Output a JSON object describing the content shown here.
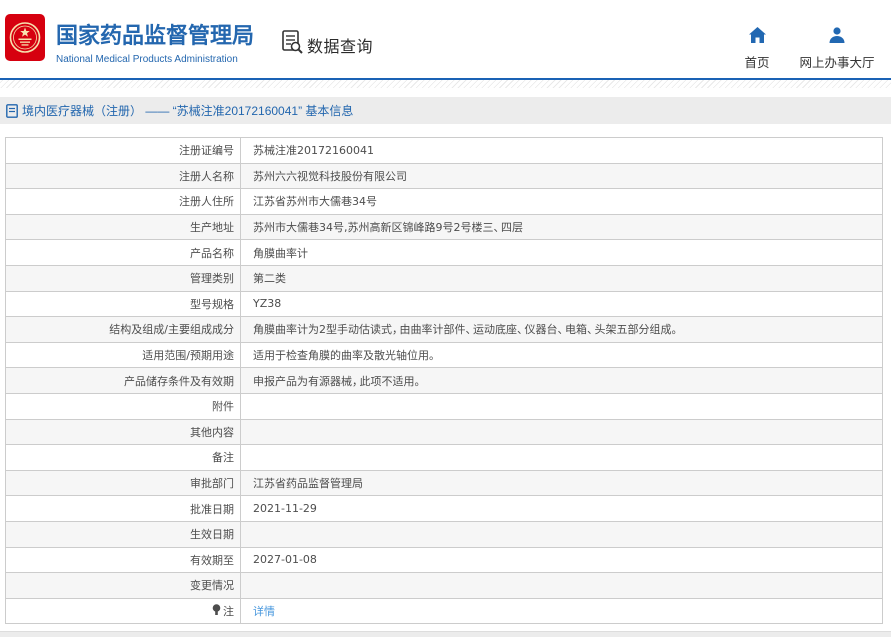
{
  "header": {
    "title_cn": "国家药品监督管理局",
    "title_en": "National Medical Products Administration",
    "section_label": "数据查询",
    "nav_home": "首页",
    "nav_hall": "网上办事大厅"
  },
  "breadcrumb": {
    "text": "境内医疗器械（注册） —— “苏械注准20172160041” 基本信息"
  },
  "table": {
    "rows": [
      {
        "label": "注册证编号",
        "value": "苏械注准20172160041"
      },
      {
        "label": "注册人名称",
        "value": "苏州六六视觉科技股份有限公司"
      },
      {
        "label": "注册人住所",
        "value": "江苏省苏州市大儒巷34号"
      },
      {
        "label": "生产地址",
        "value": "苏州市大儒巷34号,苏州高新区锦峰路9号2号楼三、四层"
      },
      {
        "label": "产品名称",
        "value": "角膜曲率计"
      },
      {
        "label": "管理类别",
        "value": "第二类"
      },
      {
        "label": "型号规格",
        "value": "YZ38"
      },
      {
        "label": "结构及组成/主要组成成分",
        "value": "角膜曲率计为2型手动估读式，由曲率计部件、运动底座、仪器台、电箱、头架五部分组成。"
      },
      {
        "label": "适用范围/预期用途",
        "value": "适用于检查角膜的曲率及散光轴位用。"
      },
      {
        "label": "产品储存条件及有效期",
        "value": "申报产品为有源器械，此项不适用。"
      },
      {
        "label": "附件",
        "value": ""
      },
      {
        "label": "其他内容",
        "value": ""
      },
      {
        "label": "备注",
        "value": ""
      },
      {
        "label": "审批部门",
        "value": "江苏省药品监督管理局"
      },
      {
        "label": "批准日期",
        "value": "2021-11-29"
      },
      {
        "label": "生效日期",
        "value": ""
      },
      {
        "label": "有效期至",
        "value": "2027-01-08"
      },
      {
        "label": "变更情况",
        "value": ""
      },
      {
        "label": "注",
        "value": "详情",
        "link": true,
        "icon": "lamp-icon"
      }
    ]
  },
  "colors": {
    "accent_blue": "#2467af",
    "line_blue": "#1a62b5",
    "link_blue": "#4596dd",
    "emblem_red": "#d6000f"
  }
}
